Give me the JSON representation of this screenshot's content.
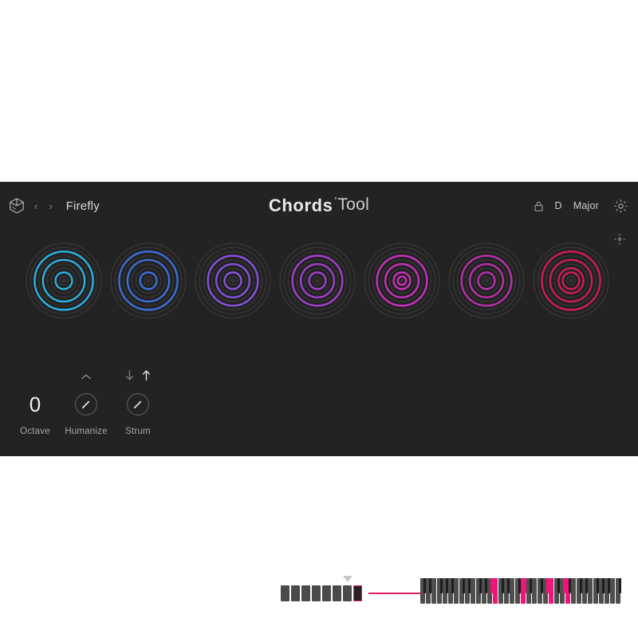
{
  "app": {
    "background_color": "#ffffff",
    "panel_color": "#232323"
  },
  "header": {
    "dice_icon": "dice-icon",
    "prev_label": "‹",
    "next_label": "›",
    "preset_name": "Firefly",
    "brand_bold": "Chords",
    "brand_tick": "'",
    "brand_light": "Tool",
    "lock_icon": "lock-icon",
    "key_root": "D",
    "key_scale": "Major",
    "gear_icon": "gear-icon",
    "move_icon": "move-icon"
  },
  "colors": {
    "accent_pink": "#e0215c",
    "key_on": "#f0137a",
    "ring_off": "#3a3738"
  },
  "chords": {
    "pads": [
      {
        "index": 1,
        "color": "#29b6e8",
        "active_rings": [
          2,
          5,
          7
        ],
        "ring_count": 9
      },
      {
        "index": 2,
        "color": "#3b72e0",
        "active_rings": [
          2,
          5,
          7
        ],
        "ring_count": 9
      },
      {
        "index": 3,
        "color": "#8a52e8",
        "active_rings": [
          2,
          4,
          6
        ],
        "ring_count": 9
      },
      {
        "index": 4,
        "color": "#a83fd6",
        "active_rings": [
          2,
          4,
          6
        ],
        "ring_count": 9
      },
      {
        "index": 5,
        "color": "#d12fc4",
        "active_rings": [
          1,
          2,
          4,
          6
        ],
        "ring_count": 9
      },
      {
        "index": 6,
        "color": "#c02fb0",
        "active_rings": [
          2,
          4,
          6
        ],
        "ring_count": 9
      },
      {
        "index": 7,
        "color": "#d61b58",
        "active_rings": [
          2,
          3,
          5,
          7
        ],
        "ring_count": 9
      }
    ]
  },
  "controls": {
    "octave": {
      "value": "0",
      "label": "Octave"
    },
    "humanize": {
      "label": "Humanize",
      "chevron_icon": "chevron-up-icon",
      "knob_angle": 45
    },
    "strum": {
      "label": "Strum",
      "down_icon": "arrow-down-icon",
      "up_icon": "arrow-up-icon",
      "active_direction": "up",
      "knob_angle": 45
    }
  },
  "sequencer": {
    "step_count": 8,
    "active_step": 8,
    "playhead_icon": "play-triangle-icon"
  },
  "keyboard": {
    "white_key_count": 36,
    "active_white_keys": [
      13,
      18,
      23,
      26
    ],
    "active_black_keys": [
      9,
      13,
      16,
      18
    ]
  }
}
